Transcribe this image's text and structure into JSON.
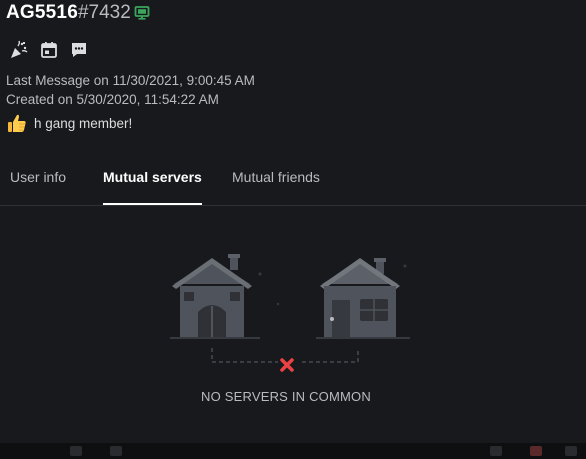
{
  "profile": {
    "username": "AG5516",
    "discriminator": "#7432",
    "status_icon": "desktop-online-icon",
    "status_color": "#3ba55c",
    "badges": [
      {
        "icon": "party-popper-icon"
      },
      {
        "icon": "calendar-icon"
      },
      {
        "icon": "message-icon"
      }
    ],
    "last_message": "Last Message on 11/30/2021, 9:00:45 AM",
    "created_on": "Created on 5/30/2020, 11:54:22 AM",
    "custom_status": {
      "emoji": "thumbs-up-icon",
      "text": "h gang member!"
    }
  },
  "tabs": [
    {
      "label": "User info",
      "active": false
    },
    {
      "label": "Mutual servers",
      "active": true
    },
    {
      "label": "Mutual friends",
      "active": false
    }
  ],
  "empty_state": {
    "illustration": "two-houses-no-connection-icon",
    "message": "NO SERVERS IN COMMON"
  },
  "colors": {
    "background": "#18191c",
    "text_primary": "#ffffff",
    "text_muted": "#b9bbbe",
    "error": "#ed4245"
  }
}
